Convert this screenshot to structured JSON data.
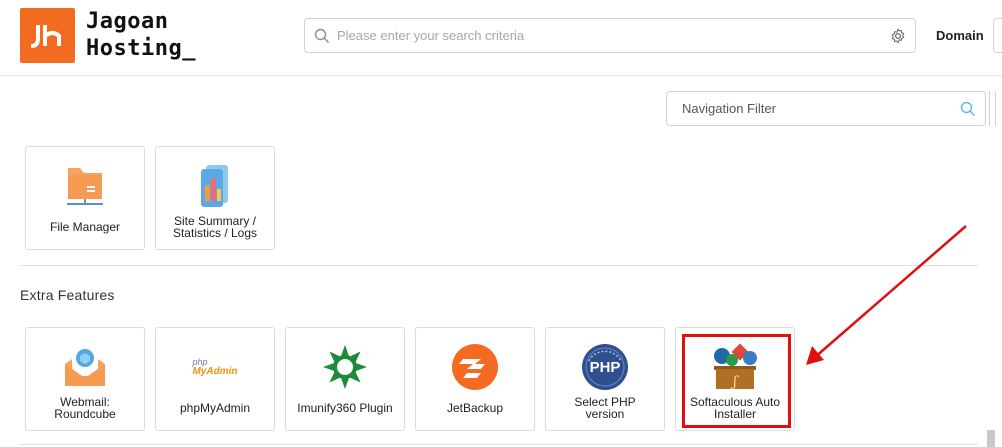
{
  "brand": {
    "name_line1": "Jagoan",
    "name_line2": "Hosting_",
    "accent": "#f26b21"
  },
  "search": {
    "placeholder": "Please enter your search criteria",
    "value": ""
  },
  "header": {
    "domain_label": "Domain"
  },
  "nav_filter": {
    "placeholder": "Navigation Filter",
    "value": ""
  },
  "files_tiles": [
    {
      "label_line1": "File Manager",
      "icon": "folder-icon"
    },
    {
      "label_line1": "Site Summary /",
      "label_line2": "Statistics / Logs",
      "icon": "statistics-icon"
    }
  ],
  "extra_features": {
    "title": "Extra Features",
    "tiles": [
      {
        "label_line1": "Webmail:",
        "label_line2": "Roundcube",
        "icon": "webmail-icon"
      },
      {
        "label_line1": "phpMyAdmin",
        "icon": "phpmyadmin-icon",
        "icon_text_top": "php",
        "icon_text_bottom": "MyAdmin"
      },
      {
        "label_line1": "Imunify360 Plugin",
        "icon": "imunify360-icon"
      },
      {
        "label_line1": "JetBackup",
        "icon": "jetbackup-icon"
      },
      {
        "label_line1": "Select PHP",
        "label_line2": "version",
        "icon": "php-icon",
        "icon_text": "PHP"
      },
      {
        "label_line1": "Softaculous Auto",
        "label_line2": "Installer",
        "icon": "softaculous-icon"
      }
    ]
  },
  "annotation": {
    "color": "#e01010"
  }
}
